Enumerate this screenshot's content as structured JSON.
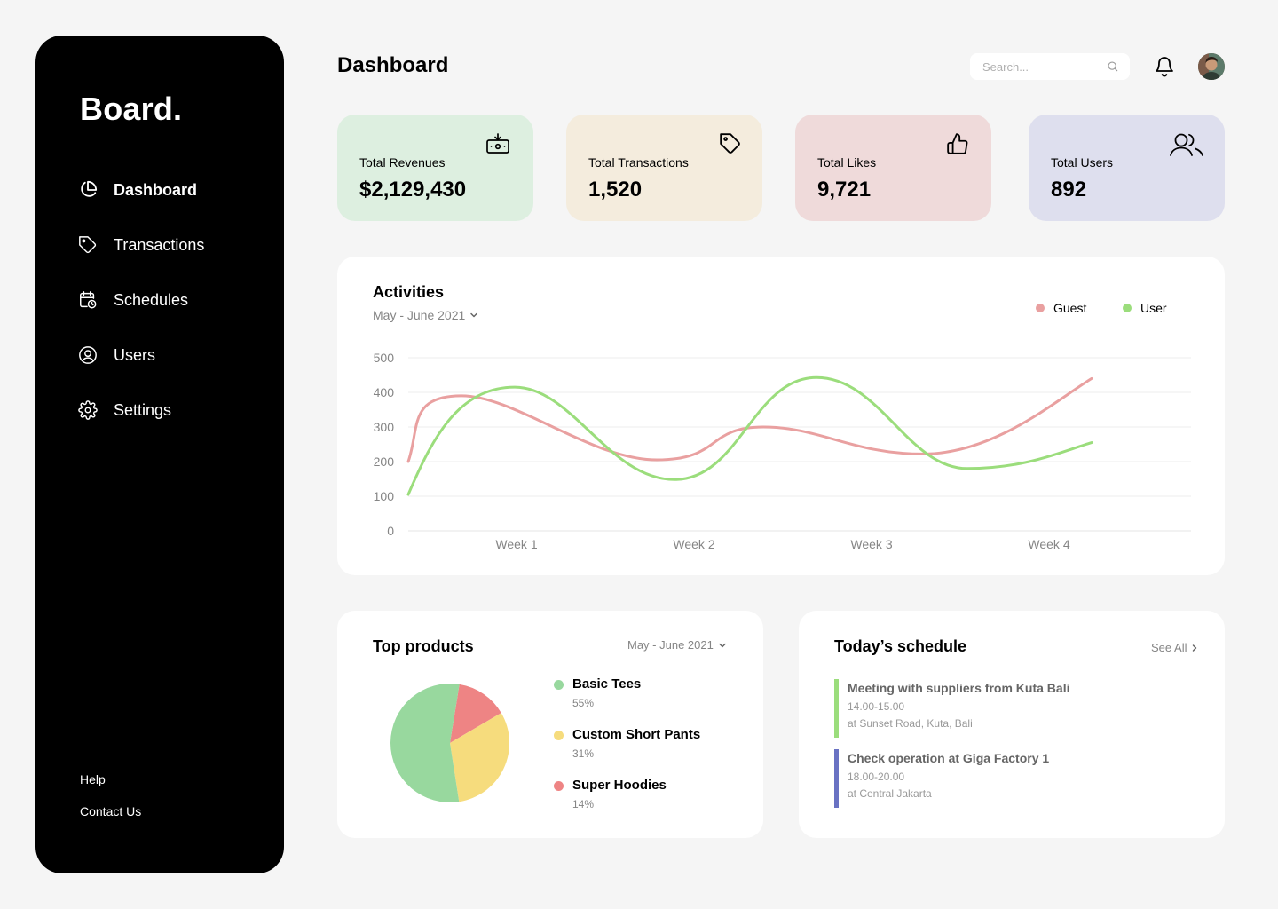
{
  "sidebar": {
    "brand": "Board.",
    "items": [
      {
        "label": "Dashboard",
        "icon": "pie-chart-icon",
        "active": true
      },
      {
        "label": "Transactions",
        "icon": "tag-icon",
        "active": false
      },
      {
        "label": "Schedules",
        "icon": "calendar-clock-icon",
        "active": false
      },
      {
        "label": "Users",
        "icon": "user-circle-icon",
        "active": false
      },
      {
        "label": "Settings",
        "icon": "gear-icon",
        "active": false
      }
    ],
    "footer": {
      "help": "Help",
      "contact": "Contact Us"
    }
  },
  "header": {
    "title": "Dashboard",
    "search_placeholder": "Search...",
    "icons": [
      "search-icon",
      "bell-icon",
      "avatar"
    ]
  },
  "stats": [
    {
      "label": "Total Revenues",
      "value": "$2,129,430",
      "icon": "money-icon",
      "color": "#DDEFE0"
    },
    {
      "label": "Total Transactions",
      "value": "1,520",
      "icon": "tag-icon",
      "color": "#F4ECDD"
    },
    {
      "label": "Total Likes",
      "value": "9,721",
      "icon": "thumbs-up-icon",
      "color": "#EFDADA"
    },
    {
      "label": "Total Users",
      "value": "892",
      "icon": "users-icon",
      "color": "#DEDFEE"
    }
  ],
  "activities": {
    "title": "Activities",
    "period": "May - June 2021",
    "chart_data": {
      "type": "line",
      "categories": [
        "Week 1",
        "Week 2",
        "Week 3",
        "Week 4"
      ],
      "y_ticks": [
        "0",
        "100",
        "200",
        "300",
        "400",
        "500"
      ],
      "ylim": [
        0,
        500
      ],
      "grid": true,
      "legend_position": "top-right",
      "series": [
        {
          "name": "Guest",
          "color": "#E9A0A0",
          "points": [
            [
              0.0,
              200
            ],
            [
              0.3,
              390
            ],
            [
              1.4,
              205
            ],
            [
              2.0,
              300
            ],
            [
              2.9,
              222
            ],
            [
              3.85,
              440
            ]
          ]
        },
        {
          "name": "User",
          "color": "#9BDD7C",
          "points": [
            [
              0.0,
              105
            ],
            [
              0.6,
              415
            ],
            [
              1.5,
              148
            ],
            [
              2.3,
              443
            ],
            [
              3.15,
              180
            ],
            [
              3.85,
              255
            ]
          ]
        }
      ]
    }
  },
  "products": {
    "title": "Top products",
    "period": "May - June 2021",
    "chart_data": {
      "type": "pie",
      "slices": [
        {
          "name": "Basic Tees",
          "label": "55%",
          "value": 55,
          "color": "#98D89E"
        },
        {
          "name": "Custom Short Pants",
          "label": "31%",
          "value": 31,
          "color": "#F6DC7D"
        },
        {
          "name": "Super Hoodies",
          "label": "14%",
          "value": 14,
          "color": "#EE8484"
        }
      ]
    }
  },
  "schedule": {
    "title": "Today’s schedule",
    "see_all": "See All",
    "items": [
      {
        "title": "Meeting with suppliers from Kuta Bali",
        "time": "14.00-15.00",
        "location": "at Sunset Road, Kuta, Bali",
        "color": "#9BDD7C"
      },
      {
        "title": "Check operation at Giga Factory 1",
        "time": "18.00-20.00",
        "location": "at Central Jakarta",
        "color": "#6972C3"
      }
    ]
  }
}
